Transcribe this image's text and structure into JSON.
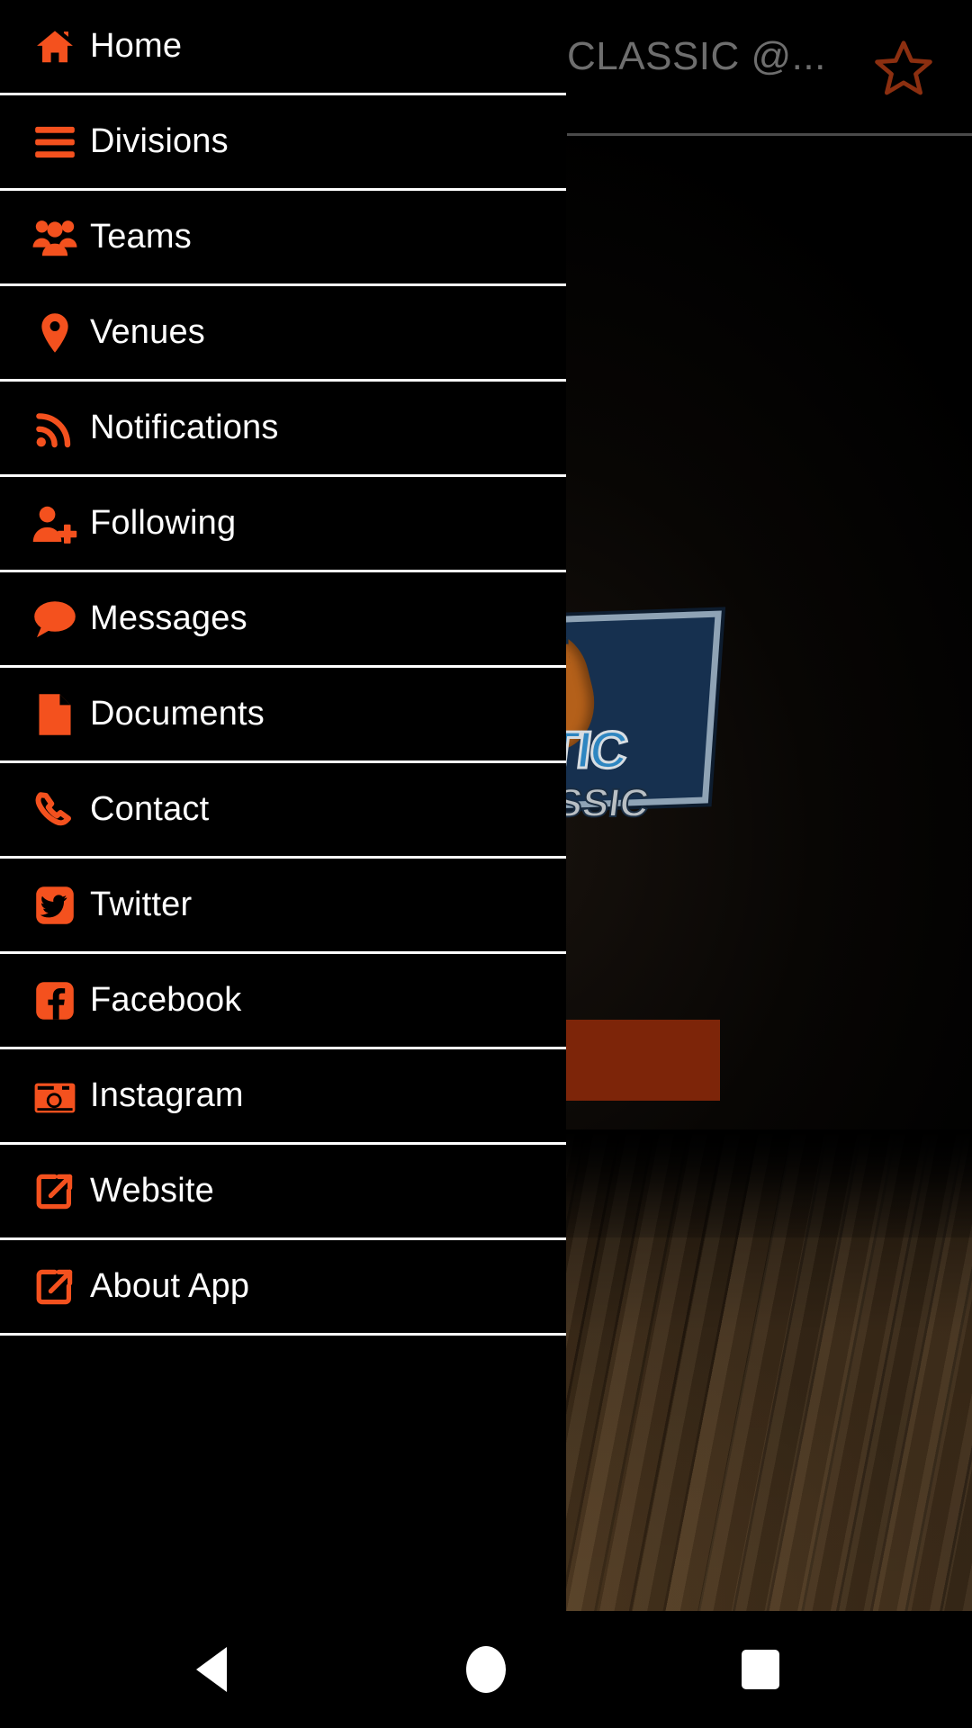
{
  "app": {
    "accent_color": "#f4511e",
    "drawer_bg": "#000000",
    "divider_color": "#ffffff",
    "title_color": "#6e6e6e"
  },
  "actionbar": {
    "title": "CLASSIC  @...",
    "favorite_icon": "star-outline-icon",
    "favorite_color": "#8c2f10"
  },
  "drawer": {
    "items": [
      {
        "label": "Home",
        "icon": "home-icon"
      },
      {
        "label": "Divisions",
        "icon": "hamburger-lines-icon"
      },
      {
        "label": "Teams",
        "icon": "people-group-icon"
      },
      {
        "label": "Venues",
        "icon": "map-pin-icon"
      },
      {
        "label": "Notifications",
        "icon": "rss-feed-icon"
      },
      {
        "label": "Following",
        "icon": "user-plus-icon"
      },
      {
        "label": "Messages",
        "icon": "chat-bubble-icon"
      },
      {
        "label": "Documents",
        "icon": "document-icon"
      },
      {
        "label": "Contact",
        "icon": "phone-icon"
      },
      {
        "label": "Twitter",
        "icon": "twitter-icon"
      },
      {
        "label": "Facebook",
        "icon": "facebook-icon"
      },
      {
        "label": "Instagram",
        "icon": "instagram-camera-icon"
      },
      {
        "label": "Website",
        "icon": "external-link-icon"
      },
      {
        "label": "About App",
        "icon": "external-link-icon"
      }
    ]
  },
  "background": {
    "logo_word_top": "NTIC",
    "logo_word_bottom": "ASSIC",
    "logo_navy": "#16304f",
    "logo_blue": "#2e86c1",
    "logo_orange": "#b4601a",
    "banner_color": "#7d2509",
    "floor_description": "wood-court-floor"
  },
  "sysnav": {
    "back_label": "back-button",
    "home_label": "home-button",
    "recent_label": "recent-apps-button"
  }
}
